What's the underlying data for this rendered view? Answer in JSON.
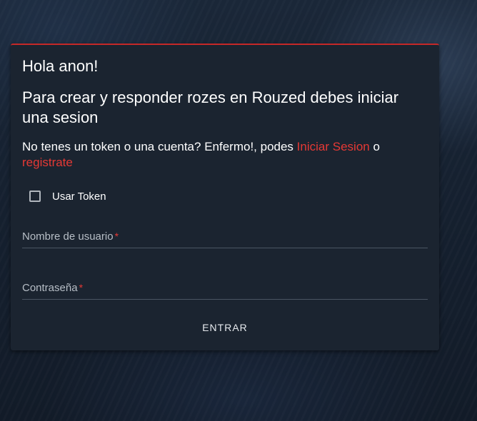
{
  "card": {
    "greeting": "Hola anon!",
    "subtitle": "Para crear y responder rozes en Rouzed debes iniciar una sesion",
    "prompt_text": "No tenes un token o una cuenta? Enfermo!, podes",
    "login_link": "Iniciar Sesion",
    "conjunction": "o",
    "register_link": "registrate"
  },
  "form": {
    "use_token_label": "Usar Token",
    "use_token_checked": false,
    "username_label": "Nombre de usuario",
    "password_label": "Contraseña",
    "required_marker": "*",
    "submit_label": "ENTRAR"
  },
  "colors": {
    "accent": "#e53935",
    "card_bg": "#1b2430",
    "card_border_top": "#c62828"
  }
}
